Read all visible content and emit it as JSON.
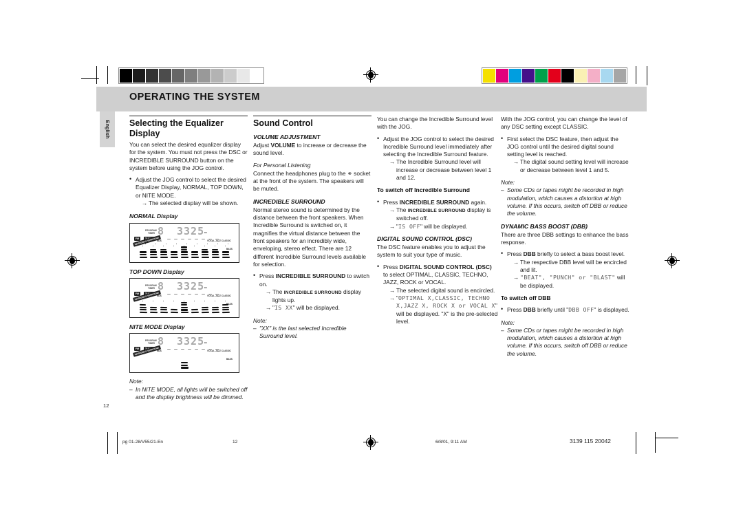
{
  "header": {
    "title": "OPERATING THE SYSTEM",
    "language_tab": "English"
  },
  "page_number_margin": "12",
  "col1": {
    "heading": "Selecting the Equalizer Display",
    "intro": "You can select the desired equalizer display for the system. You must not press the DSC or INCREDIBLE SURROUND button on the system before using the JOG control.",
    "bullet": "Adjust the JOG control to select the desired Equalizer Display, NORMAL, TOP DOWN, or NITE MODE.",
    "bullet_arrow": "The selected display will be shown.",
    "display_labels": {
      "normal": "NORMAL Display",
      "topdown": "TOP DOWN Display",
      "nite": "NITE MODE Display"
    },
    "lcd": {
      "digit": "8",
      "track": "3325",
      "left_tiny_1": "PROGRAM",
      "left_tiny_2": "TIMER",
      "chip_fm": "FM",
      "chip_tuner": "TUNER",
      "chip_rds": "RDS",
      "chip_incredible": "INCREDIBLE SURROUND",
      "right_tiny": "VOCAL  JAZZ  CLASSIC",
      "bass_tiny": "BASS"
    },
    "note_label": "Note:",
    "note_text": "In NITE MODE, all lights will be switched off and the display brightness will be dimmed."
  },
  "col2": {
    "heading": "Sound Control",
    "volume_heading": "VOLUME ADJUSTMENT",
    "volume_text_a": "Adjust ",
    "volume_bold": "VOLUME",
    "volume_text_b": " to increase or decrease the sound level.",
    "personal_heading": "For Personal Listening",
    "personal_text_a": "Connect the headphones plug to the ",
    "personal_text_b": " socket at the front of the system. The speakers will be muted.",
    "is_heading": "INCREDIBLE SURROUND",
    "is_text": "Normal stereo sound is determined by the distance between the front speakers. When Incredible Surround is switched on, it magnifies the virtual distance between the front speakers for an incredibly wide, enveloping, stereo effect. There are 12 different Incredible Surround levels available for selection.",
    "is_bullet_a": "Press ",
    "is_bullet_bold": "INCREDIBLE SURROUND",
    "is_bullet_b": " to switch on.",
    "is_arrow1_a": "The ",
    "is_arrow1_bold": "INCREDIBLE SURROUND",
    "is_arrow1_b": " display lights up.",
    "is_arrow2_a": "\"",
    "is_arrow2_lcd": "IS  XX",
    "is_arrow2_b": "\" will be displayed.",
    "note_label": "Note:",
    "note_text_a": "\"XX\" is the last selected Incredible Surround level."
  },
  "col3": {
    "intro": "You can change the Incredible Surround level with the JOG.",
    "bullet": "Adjust the JOG control to select the desired Incredible Surround level immediately after selecting the Incredible Surround feature.",
    "bullet_arrow": "The Incredible Surround level will increase or decrease between level 1 and 12.",
    "switchoff_heading": "To switch off Incredible Surround",
    "switchoff_bullet_a": "Press ",
    "switchoff_bullet_bold": "INCREDIBLE SURROUND",
    "switchoff_bullet_b": " again.",
    "switchoff_arrow1_a": "The ",
    "switchoff_arrow1_bold": "INCREDIBLE SURROUND",
    "switchoff_arrow1_b": " display is switched off.",
    "switchoff_arrow2_a": "\"",
    "switchoff_arrow2_lcd": "IS OFF",
    "switchoff_arrow2_b": "\" will be displayed.",
    "dsc_heading": "DIGITAL SOUND CONTROL  (DSC)",
    "dsc_text": "The DSC feature enables you to adjust the system to suit your type of music.",
    "dsc_bullet_a": "Press ",
    "dsc_bullet_bold1": "DIGITAL SOUND CONTROL",
    "dsc_bullet_bold2": "(DSC)",
    "dsc_bullet_b": " to select OPTIMAL, CLASSIC, TECHNO, JAZZ, ROCK or VOCAL.",
    "dsc_arrow1": "The selected digital sound is encircled.",
    "dsc_arrow2_a": "\"",
    "dsc_arrow2_lcd": "OPTIMAL X,CLASSIC, TECHNO X,JAZZ X, ROCK X or VOCAL X",
    "dsc_arrow2_b": "\" will be displayed.  \"X\" is the pre-selected level."
  },
  "col4": {
    "intro": "With the JOG control, you can change the level of any DSC setting except CLASSIC.",
    "bullet": "First select the DSC feature, then adjust the JOG control until the desired digital sound setting level is reached.",
    "bullet_arrow": "The digital sound setting level will increase or decrease between level 1 and 5.",
    "note_label": "Note:",
    "note_text": "Some CDs or tapes might be recorded in high modulation, which causes a distortion at high volume. If this occurs, switch off DBB or reduce the volume.",
    "dbb_heading": "DYNAMIC BASS BOOST (DBB)",
    "dbb_text": "There are three DBB settings to enhance the bass response.",
    "dbb_bullet_a": "Press ",
    "dbb_bullet_bold": "DBB",
    "dbb_bullet_b": " briefly to select a bass boost level.",
    "dbb_arrow1": "The respective DBB level will be encircled and lit.",
    "dbb_arrow2_lcd": "\"BEAT\", \"PUNCH\" or \"BLAST\"",
    "dbb_arrow2_b": " will be displayed.",
    "switchoff_heading": "To switch off DBB",
    "switchoff_bullet_a": "Press ",
    "switchoff_bullet_bold": "DBB",
    "switchoff_bullet_b": " briefly until \"",
    "switchoff_bullet_lcd": "DBB OFF",
    "switchoff_bullet_c": "\" is displayed."
  },
  "footer": {
    "filename": "pg 01-28/V55/21-En",
    "page": "12",
    "timestamp": "6/8/01, 9:11 AM",
    "doc_code": "3139 115 20042"
  },
  "calibration": {
    "grayscale": [
      "#000000",
      "#1c1c1c",
      "#333333",
      "#4c4c4c",
      "#666666",
      "#7f7f7f",
      "#999999",
      "#b3b3b3",
      "#cccccc",
      "#e8e8e8",
      "#ffffff"
    ],
    "colors": [
      "#f5e000",
      "#e2007d",
      "#009ee0",
      "#45108a",
      "#00a14b",
      "#e3001b",
      "#000000",
      "#faf0b4",
      "#f4afc7",
      "#a8d8f0",
      "#a6a6a6"
    ]
  }
}
